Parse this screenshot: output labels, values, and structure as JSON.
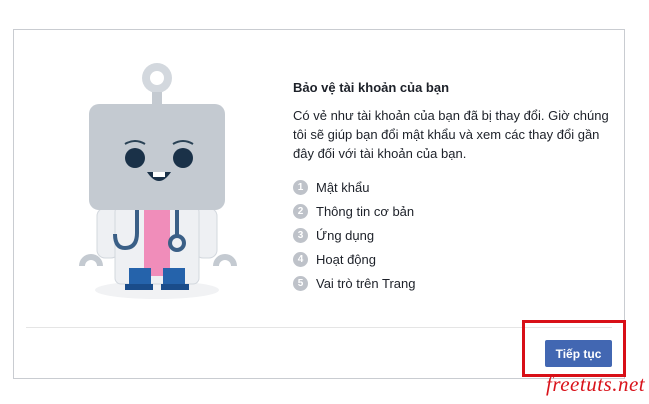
{
  "dialog": {
    "title": "Bảo vệ tài khoản của bạn",
    "description": "Có vẻ như tài khoản của bạn đã bị thay đổi. Giờ chúng tôi sẽ giúp bạn đổi mật khẩu và xem các thay đổi gần đây đối với tài khoản của bạn.",
    "steps": [
      {
        "number": "1",
        "label": "Mật khẩu"
      },
      {
        "number": "2",
        "label": "Thông tin cơ bản"
      },
      {
        "number": "3",
        "label": "Ứng dụng"
      },
      {
        "number": "4",
        "label": "Hoạt động"
      },
      {
        "number": "5",
        "label": "Vai trò trên Trang"
      }
    ],
    "continue_label": "Tiếp tục"
  },
  "watermark": "freetuts.net",
  "colors": {
    "primary_button": "#4267b2",
    "highlight_border": "#d80f17",
    "step_badge": "#bec2c9"
  }
}
